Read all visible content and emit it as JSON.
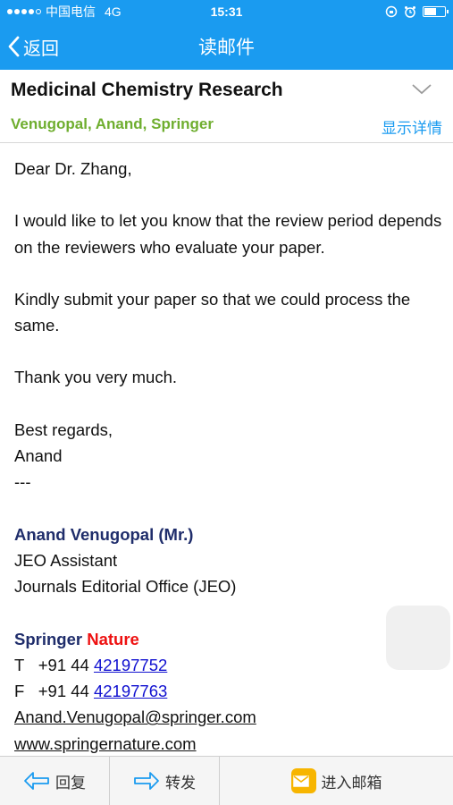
{
  "status": {
    "carrier": "中国电信",
    "network": "4G",
    "time": "15:31"
  },
  "nav": {
    "back_label": "返回",
    "title": "读邮件"
  },
  "email": {
    "subject": "Medicinal Chemistry Research",
    "from": "Venugopal, Anand, Springer",
    "details_label": "显示详情",
    "greeting": "Dear Dr. Zhang,",
    "paragraph1": "I would like to let you know that the review period depends on the reviewers who evaluate your paper.",
    "paragraph2": "Kindly submit your paper so that we could process the same.",
    "thanks": "Thank you very much.",
    "closing": "Best regards,",
    "closing_name": "Anand",
    "separator": "---",
    "signature": {
      "name": "Anand Venugopal (Mr.)",
      "role": "JEO Assistant",
      "office": "Journals Editorial Office (JEO)",
      "brand_springer": "Springer",
      "brand_nature": "Nature",
      "phone_label": "T",
      "phone_prefix": "+91 44",
      "phone_number": "42197752",
      "fax_label": "F",
      "fax_prefix": "+91 44",
      "fax_number": "42197763",
      "email": "Anand.Venugopal@springer.com",
      "website": "www.springernature.com"
    }
  },
  "toolbar": {
    "reply_label": "回复",
    "forward_label": "转发",
    "mailbox_label": "进入邮箱"
  },
  "colors": {
    "accent": "#1a9bf0",
    "sender": "#6fae2f",
    "signature_name": "#1f2d6b",
    "nature_red": "#ee1111"
  }
}
